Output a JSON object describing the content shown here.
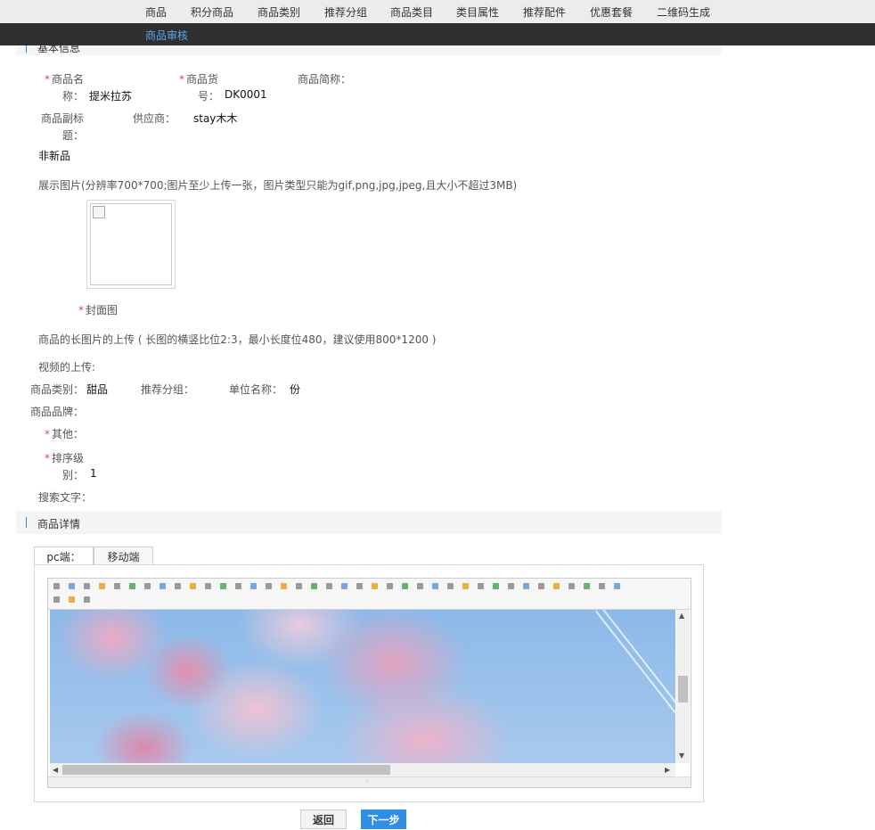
{
  "nav": {
    "items": [
      "商品",
      "积分商品",
      "商品类别",
      "推荐分组",
      "商品类目",
      "类目属性",
      "推荐配件",
      "优惠套餐",
      "二维码生成"
    ],
    "sub_item": "商品审核"
  },
  "basic_info": {
    "section_title": "基本信息",
    "product_name_label_1": "商品名",
    "product_name_label_2": "称：",
    "product_name_value": "提米拉苏",
    "product_code_label_1": "商品货",
    "product_code_label_2": "号：",
    "product_code_value": "DK0001",
    "short_name_label": "商品简称：",
    "subtitle_label_1": "商品副标",
    "subtitle_label_2": "题：",
    "supplier_label": "供应商：",
    "supplier_value": "stay木木",
    "new_flag": "非新品",
    "display_image_label": "展示图片(分辨率700*700;图片至少上传一张，图片类型只能为gif,png,jpg,jpeg,且大小不超过3MB)",
    "cover_label": "封面图",
    "long_image_label": "商品的长图片的上传 ( 长图的横竖比位2:3，最小长度位480，建议使用800*1200 )",
    "video_label": "视频的上传:",
    "category_label": "商品类别：",
    "category_value": "甜品",
    "group_label": "推荐分组：",
    "unit_label": "单位名称：",
    "unit_value": "份",
    "brand_label": "商品品牌：",
    "other_label": "其他：",
    "sort_label_1": "排序级",
    "sort_label_2": "别：",
    "sort_value": "1",
    "search_label": "搜索文字：",
    "required_mark": "*"
  },
  "details": {
    "section_title": "商品详情",
    "tabs": [
      "pc端：",
      "移动端"
    ]
  },
  "editor": {
    "toolbar_icons": [
      "source-icon",
      "undo-icon",
      "redo-icon",
      "preview-icon",
      "cut-icon",
      "copy-icon",
      "paste-icon",
      "paste-text-icon",
      "paste-word-icon",
      "align-left-icon",
      "align-center-icon",
      "align-right-icon",
      "justify-icon",
      "ordered-list-icon",
      "unordered-list-icon",
      "indent-icon",
      "outdent-icon",
      "subscript-icon",
      "superscript-icon",
      "clear-format-icon",
      "select-all-icon",
      "select-icon",
      "heading-icon",
      "font-family-icon",
      "font-size-icon",
      "font-color-icon",
      "highlight-icon",
      "bold-icon",
      "italic-icon",
      "underline-icon",
      "strikethrough-icon",
      "table-icon",
      "image-icon",
      "media-icon",
      "flash-icon",
      "insert-file-icon",
      "hr-icon",
      "pagebreak-icon",
      "anchor-icon",
      "link-icon",
      "unlink-icon"
    ]
  },
  "actions": {
    "back": "返回",
    "next": "下一步"
  }
}
